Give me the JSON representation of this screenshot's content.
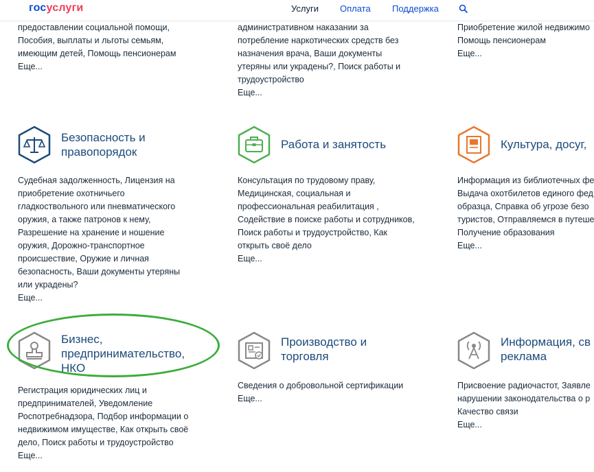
{
  "header": {
    "logo_part1": "гос",
    "logo_part2": "услуги",
    "nav": [
      "Услуги",
      "Оплата",
      "Поддержка"
    ],
    "search_icon": "search-icon"
  },
  "top_row": [
    {
      "lines": [
        "предоставлении социальной помощи,",
        "Пособия, выплаты и льготы семьям,",
        "имеющим детей, Помощь пенсионерам"
      ],
      "more": "Еще..."
    },
    {
      "lines": [
        "административном наказании за",
        "потребление наркотических средств без",
        "назначения врача, Ваши документы",
        "утеряны или украдены?, Поиск работы и",
        "трудоустройство"
      ],
      "more": "Еще..."
    },
    {
      "lines": [
        "Приобретение жилой недвижимо",
        "Помощь пенсионерам"
      ],
      "more": "Еще..."
    }
  ],
  "categories_row2": [
    {
      "title": "Безопасность и правопорядок",
      "icon": "scales-icon",
      "color": "#1c4a7a",
      "desc": "Судебная задолженность, Лицензия на приобретение охотничьего гладкоствольного или пневматического оружия, а также патронов к нему, Разрешение на хранение и ношение оружия, Дорожно-транспортное происшествие, Оружие и личная безопасность, Ваши документы утеряны или украдены?",
      "more": "Еще..."
    },
    {
      "title": "Работа и занятость",
      "icon": "briefcase-icon",
      "color": "#4caf50",
      "desc": "Консультация по трудовому праву, Медицинская, социальная и профессиональная реабилитация , Содействие в поиске работы и сотрудников, Поиск работы и трудоустройство, Как открыть своё дело",
      "more": "Еще..."
    },
    {
      "title": "Культура, досуг,",
      "icon": "book-icon",
      "color": "#e8772e",
      "desc": "Информация из библиотечных фе Выдача охотбилетов единого фед образца, Справка об угрозе безо туристов, Отправляемся в путеше Получение образования",
      "more": "Еще..."
    }
  ],
  "categories_row3": [
    {
      "title": "Бизнес, предпринимательство, НКО",
      "icon": "stamp-icon",
      "color": "#888888",
      "desc": "Регистрация юридических лиц и предпринимателей, Уведомление Роспотребнадзора, Подбор информации о недвижимом имуществе, Как открыть своё дело, Поиск работы и трудоустройство",
      "more": "Еще..."
    },
    {
      "title": "Производство и торговля",
      "icon": "certificate-icon",
      "color": "#888888",
      "desc": "Сведения о добровольной сертификации",
      "more": "Еще..."
    },
    {
      "title": "Информация, св реклама",
      "icon": "antenna-icon",
      "color": "#888888",
      "desc": "Присвоение радиочастот, Заявле нарушении законодательства о р Качество связи",
      "more": "Еще..."
    }
  ],
  "lines_row2": [
    [
      "Судебная задолженность, Лицензия на",
      "приобретение охотничьего",
      "гладкоствольного или пневматического",
      "оружия, а также патронов к нему,",
      "Разрешение на хранение и ношение",
      "оружия, Дорожно-транспортное",
      "происшествие, Оружие и личная",
      "безопасность, Ваши документы утеряны",
      "или украдены?"
    ],
    [
      "Консультация по трудовому праву,",
      "Медицинская, социальная и",
      "профессиональная реабилитация ,",
      "Содействие в поиске работы и сотрудников,",
      "Поиск работы и трудоустройство, Как",
      "открыть своё дело"
    ],
    [
      "Информация из библиотечных фе",
      "Выдача охотбилетов единого фед",
      "образца, Справка об угрозе безо",
      "туристов, Отправляемся в путеше",
      "Получение образования"
    ]
  ],
  "lines_row3": [
    [
      "Регистрация юридических лиц и",
      "предпринимателей, Уведомление",
      "Роспотребнадзора, Подбор информации о",
      "недвижимом имуществе, Как открыть своё",
      "дело, Поиск работы и трудоустройство"
    ],
    [
      "Сведения о добровольной сертификации"
    ],
    [
      "Присвоение радиочастот, Заявле",
      "нарушении законодательства о р",
      "Качество связи"
    ]
  ],
  "titles_row2": [
    [
      "Безопасность и",
      "правопорядок"
    ],
    [
      "Работа и занятость"
    ],
    [
      "Культура, досуг,"
    ]
  ],
  "titles_row3": [
    [
      "Бизнес,",
      "предпринимательство,",
      "НКО"
    ],
    [
      "Производство и",
      "торговля"
    ],
    [
      "Информация, св",
      "реклама"
    ]
  ],
  "highlight_color": "#3cac3c"
}
